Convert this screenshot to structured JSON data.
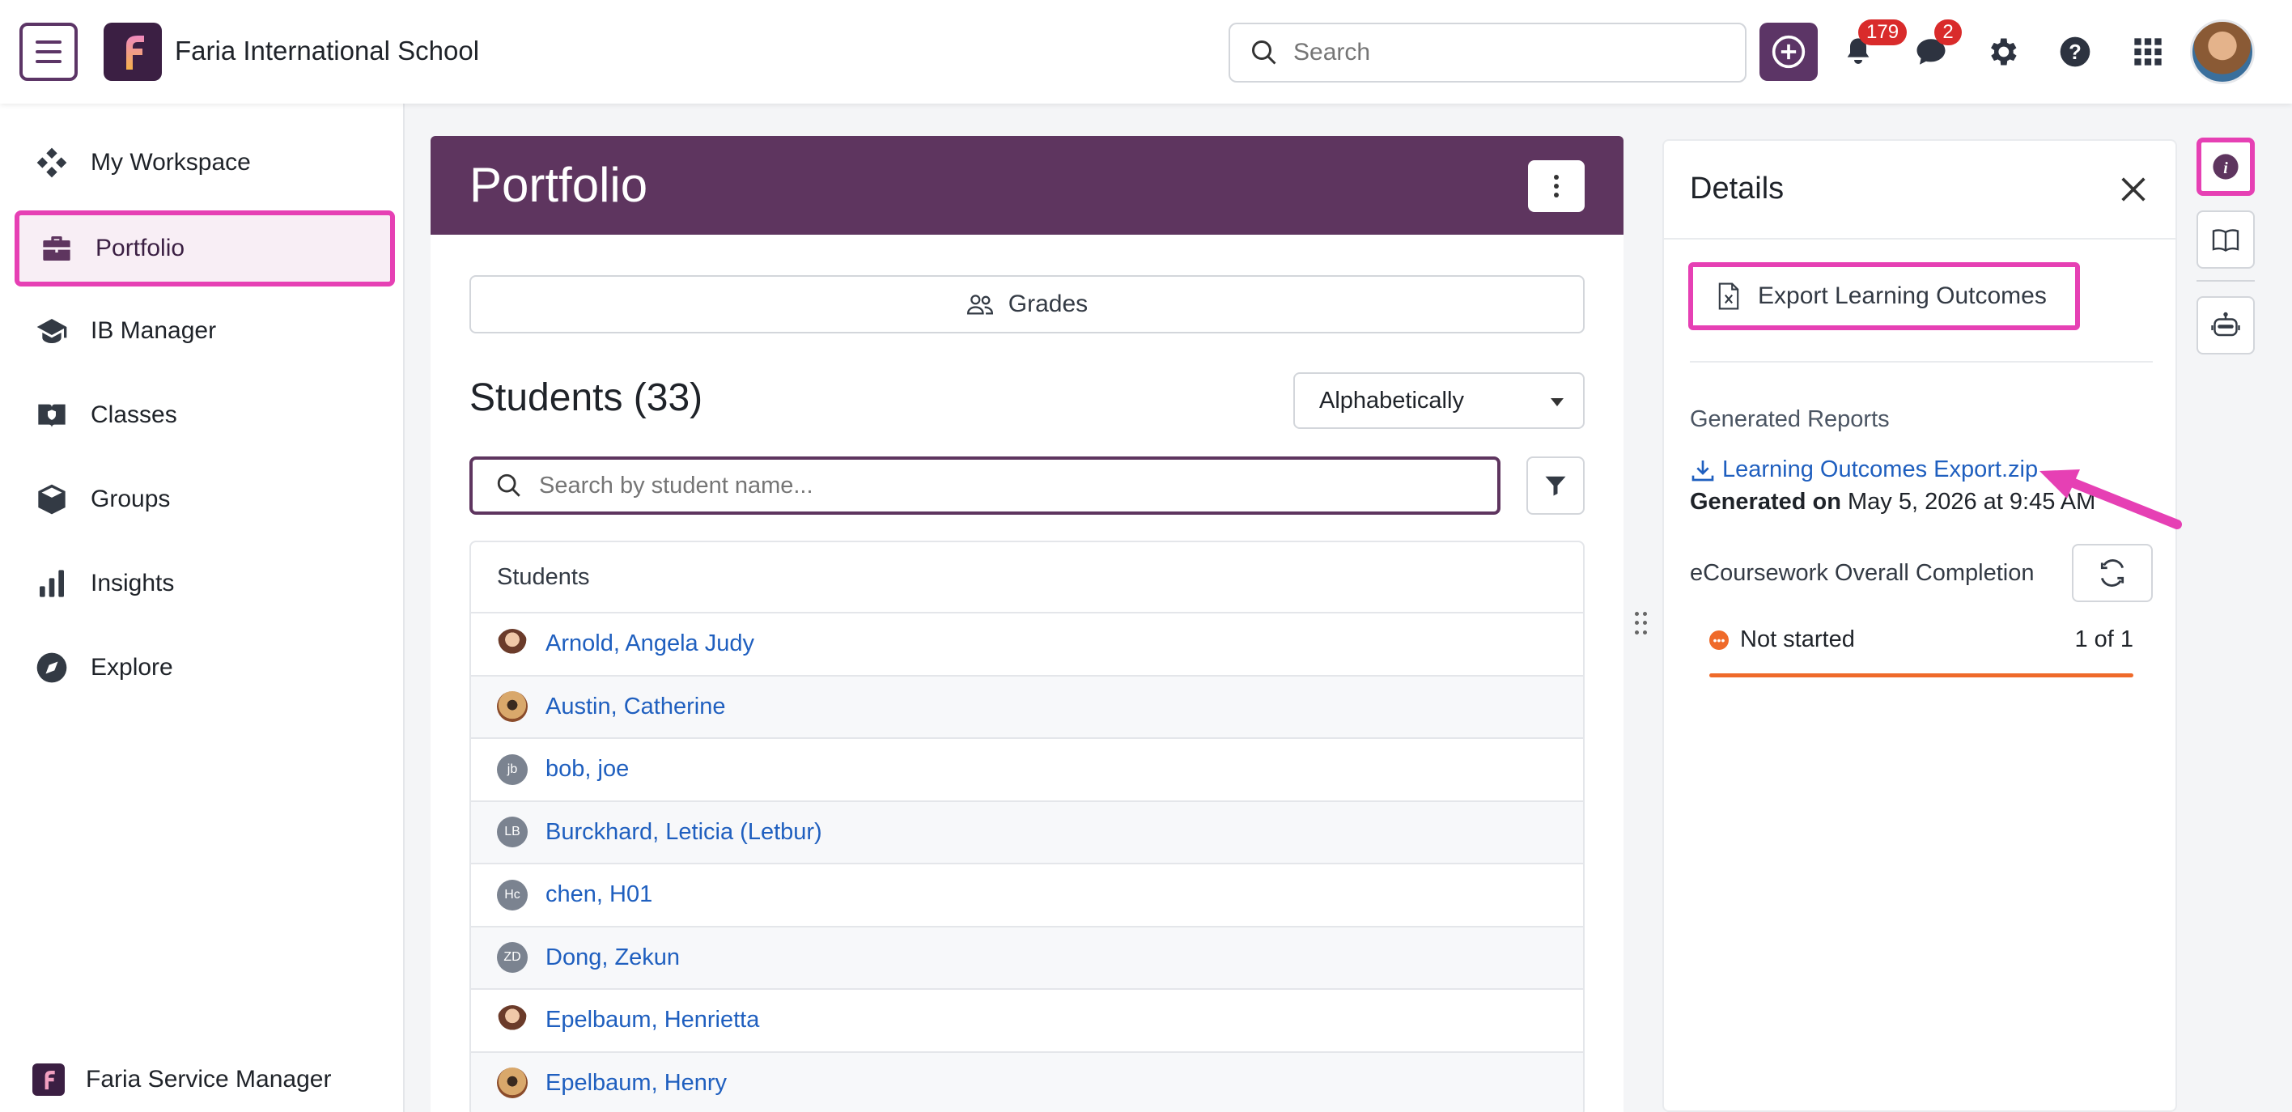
{
  "header": {
    "school_name": "Faria International School",
    "search_placeholder": "Search",
    "notifications_count": "179",
    "messages_count": "2"
  },
  "sidebar": {
    "items": [
      {
        "label": "My Workspace",
        "icon": "diamond-grid-icon"
      },
      {
        "label": "Portfolio",
        "icon": "briefcase-icon",
        "active": true
      },
      {
        "label": "IB Manager",
        "icon": "graduation-cap-icon"
      },
      {
        "label": "Classes",
        "icon": "book-shield-icon"
      },
      {
        "label": "Groups",
        "icon": "cube-icon"
      },
      {
        "label": "Insights",
        "icon": "bar-chart-icon"
      },
      {
        "label": "Explore",
        "icon": "compass-icon"
      }
    ],
    "footer_label": "Faria Service Manager"
  },
  "main": {
    "title": "Portfolio",
    "grades_label": "Grades",
    "students_title": "Students (33)",
    "sort_value": "Alphabetically",
    "student_search_placeholder": "Search by student name...",
    "table_header": "Students",
    "students": [
      {
        "name": "Arnold, Angela Judy",
        "initials": ""
      },
      {
        "name": "Austin, Catherine",
        "initials": ""
      },
      {
        "name": "bob, joe",
        "initials": "jb"
      },
      {
        "name": "Burckhard, Leticia (Letbur)",
        "initials": "LB"
      },
      {
        "name": "chen, H01",
        "initials": "Hc"
      },
      {
        "name": "Dong, Zekun",
        "initials": "ZD"
      },
      {
        "name": "Epelbaum, Henrietta",
        "initials": ""
      },
      {
        "name": "Epelbaum, Henry",
        "initials": ""
      }
    ]
  },
  "details": {
    "title": "Details",
    "export_label": "Export Learning Outcomes",
    "generated_reports_label": "Generated Reports",
    "report_link": "Learning Outcomes Export.zip",
    "generated_on_label": "Generated on",
    "generated_on_value": "May 5, 2026 at 9:45 AM",
    "ecoursework_label": "eCoursework Overall Completion",
    "status_label": "Not started",
    "status_count": "1 of 1"
  },
  "colors": {
    "brand": "#5e355f",
    "highlight": "#e640b4",
    "link": "#1f5fbf",
    "status_orange": "#ef6a2a",
    "badge_red": "#d92b2b"
  }
}
